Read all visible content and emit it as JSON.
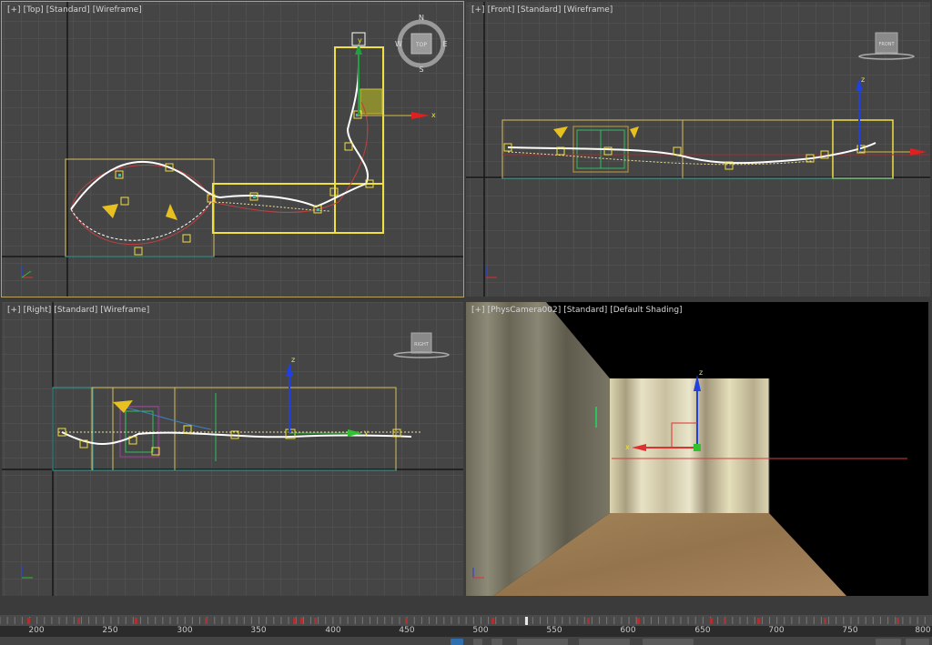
{
  "viewports": {
    "top": {
      "tokens": [
        "[+]",
        "[Top]",
        "[Standard]",
        "[Wireframe]"
      ]
    },
    "front": {
      "tokens": [
        "[+]",
        "[Front]",
        "[Standard]",
        "[Wireframe]"
      ]
    },
    "right": {
      "tokens": [
        "[+]",
        "[Right]",
        "[Standard]",
        "[Wireframe]"
      ]
    },
    "camera": {
      "tokens": [
        "[+]",
        "[PhysCamera002]",
        "[Standard]",
        "[Default Shading]"
      ]
    }
  },
  "viewcube": {
    "top_face": "TOP",
    "front_face": "FRONT",
    "right_face": "RIGHT",
    "compass": {
      "n": "N",
      "s": "S",
      "e": "E",
      "w": "W"
    }
  },
  "axes": {
    "x": "x",
    "y": "y",
    "z": "z"
  },
  "timeline": {
    "ticks": [
      "200",
      "250",
      "300",
      "350",
      "400",
      "450",
      "500",
      "550",
      "600",
      "650",
      "700",
      "750",
      "800"
    ]
  },
  "colors": {
    "grid": "#555555",
    "grid_major": "#151515",
    "selection_yellow": "#f0e040",
    "path_white": "#ffffff",
    "path_red": "#c84040",
    "axis_red": "#e03030",
    "axis_green": "#30c030",
    "axis_blue": "#2040e0",
    "floor": "#9a7a4e"
  }
}
